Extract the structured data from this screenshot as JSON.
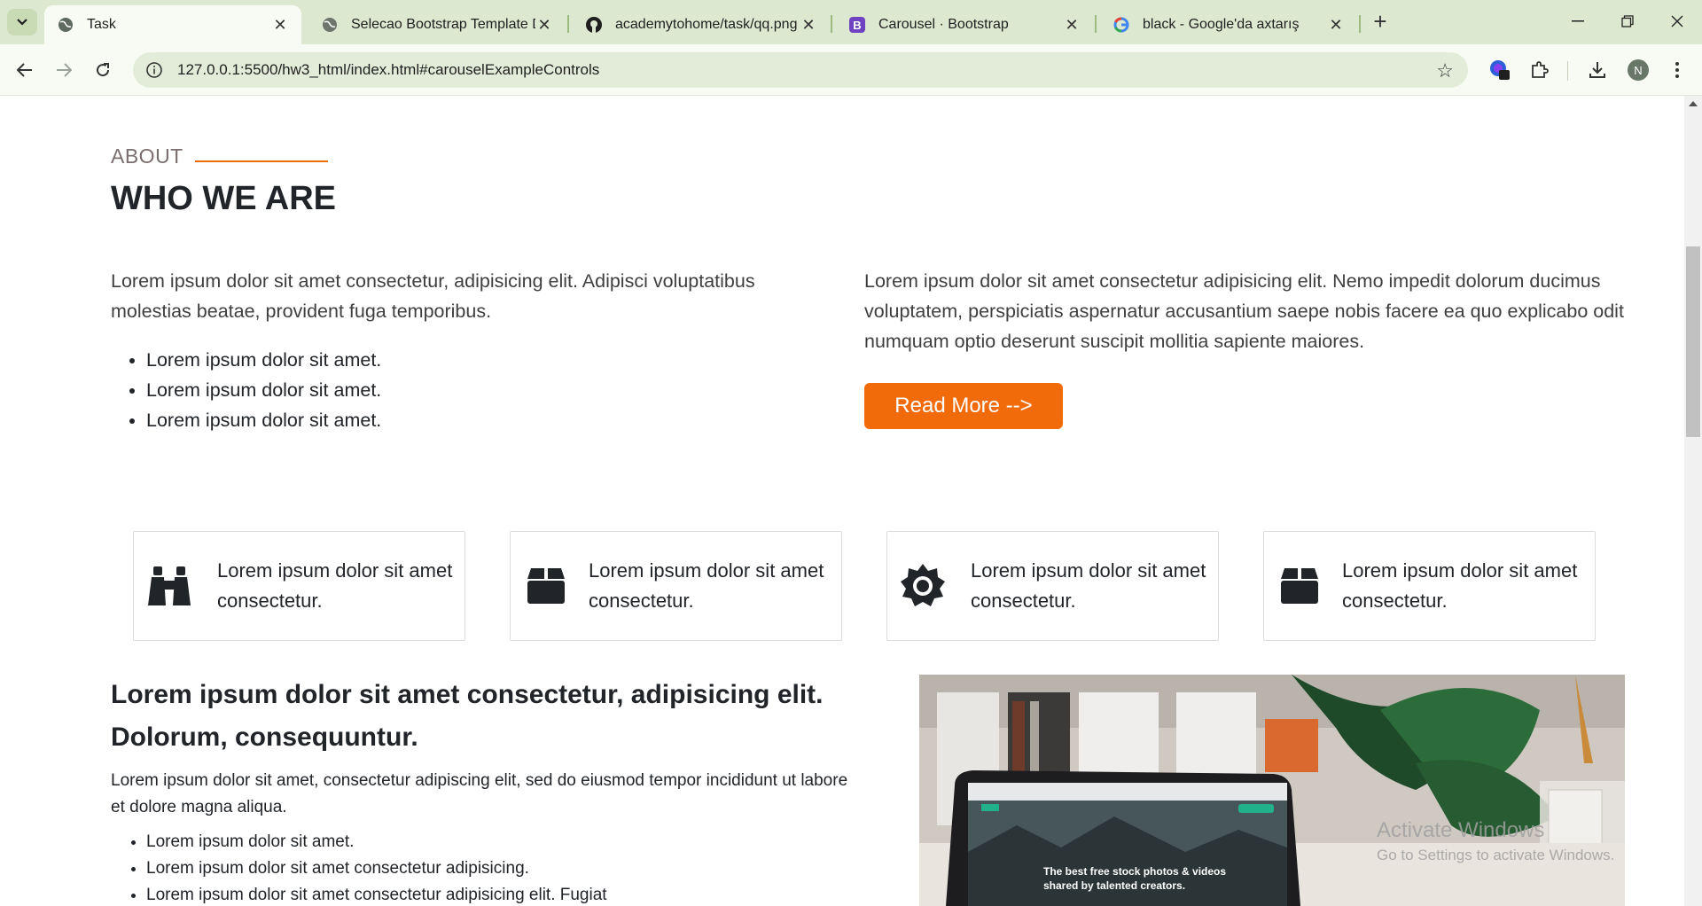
{
  "browser": {
    "tabs": [
      {
        "title": "Task",
        "active": true,
        "favicon": "globe-icon"
      },
      {
        "title": "Selecao Bootstrap Template De",
        "active": false,
        "favicon": "globe-icon"
      },
      {
        "title": "academytohome/task/qq.png a",
        "active": false,
        "favicon": "github-icon"
      },
      {
        "title": "Carousel · Bootstrap",
        "active": false,
        "favicon": "bootstrap-icon"
      },
      {
        "title": "black - Google'da axtarış",
        "active": false,
        "favicon": "google-icon"
      }
    ],
    "url": "127.0.0.1:5500/hw3_html/index.html#carouselExampleControls",
    "profile_initial": "N",
    "accent": "#dde8d0"
  },
  "about": {
    "label": "ABOUT",
    "heading": "WHO WE ARE",
    "left_paragraph": "Lorem ipsum dolor sit amet consectetur, adipisicing elit. Adipisci voluptatibus molestias beatae, provident fuga temporibus.",
    "list": [
      "Lorem ipsum dolor sit amet.",
      "Lorem ipsum dolor sit amet.",
      "Lorem ipsum dolor sit amet."
    ],
    "right_paragraph": "Lorem ipsum dolor sit amet consectetur adipisicing elit. Nemo impedit dolorum ducimus voluptatem, perspiciatis aspernatur accusantium saepe nobis facere ea quo explicabo odit numquam optio deserunt suscipit mollitia sapiente maiores.",
    "button_label": "Read More -->",
    "button_color": "#f26b0b"
  },
  "features": [
    {
      "icon": "binoculars-icon",
      "line1": "Lorem ipsum dolor sit amet",
      "line2": "consectetur."
    },
    {
      "icon": "box-icon",
      "line1": "Lorem ipsum dolor sit amet",
      "line2": "consectetur."
    },
    {
      "icon": "gear-icon",
      "line1": "Lorem ipsum dolor sit amet",
      "line2": "consectetur."
    },
    {
      "icon": "box-icon",
      "line1": "Lorem ipsum dolor sit amet",
      "line2": "consectetur."
    }
  ],
  "section2": {
    "heading_line1": "Lorem ipsum dolor sit amet consectetur, adipisicing elit.",
    "heading_line2": "Dolorum, consequuntur.",
    "paragraph": "Lorem ipsum dolor sit amet, consectetur adipiscing elit, sed do eiusmod tempor incididunt ut labore et dolore magna aliqua.",
    "list": [
      "Lorem ipsum dolor sit amet.",
      "Lorem ipsum dolor sit amet consectetur adipisicing.",
      "Lorem ipsum dolor sit amet consectetur adipisicing elit. Fugiat"
    ],
    "photo_caption_line1": "The best free stock photos & videos",
    "photo_caption_line2": "shared by talented creators."
  },
  "watermark": {
    "line1": "Activate Windows",
    "line2": "Go to Settings to activate Windows."
  }
}
